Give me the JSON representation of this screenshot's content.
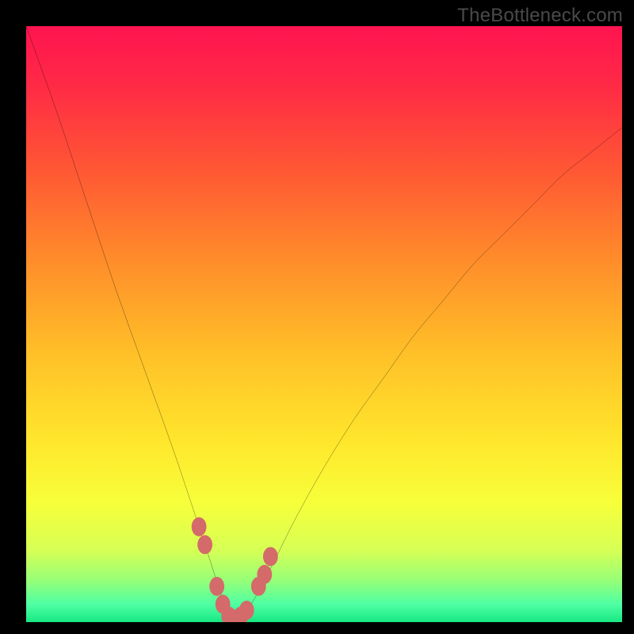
{
  "watermark": "TheBottleneck.com",
  "gradient_stops": [
    {
      "offset": 0.0,
      "color": "#ff1450"
    },
    {
      "offset": 0.1,
      "color": "#ff2a45"
    },
    {
      "offset": 0.25,
      "color": "#ff5a33"
    },
    {
      "offset": 0.4,
      "color": "#ff8f2a"
    },
    {
      "offset": 0.55,
      "color": "#ffc028"
    },
    {
      "offset": 0.7,
      "color": "#ffe72c"
    },
    {
      "offset": 0.8,
      "color": "#f7ff3a"
    },
    {
      "offset": 0.88,
      "color": "#d6ff55"
    },
    {
      "offset": 0.93,
      "color": "#96ff77"
    },
    {
      "offset": 0.97,
      "color": "#4fffa4"
    },
    {
      "offset": 1.0,
      "color": "#17e884"
    }
  ],
  "chart_data": {
    "type": "line",
    "title": "",
    "xlabel": "",
    "ylabel": "",
    "xlim": [
      0,
      100
    ],
    "ylim": [
      0,
      100
    ],
    "grid": false,
    "x": [
      0,
      5,
      10,
      15,
      20,
      25,
      30,
      33,
      35,
      37,
      40,
      45,
      50,
      55,
      60,
      65,
      70,
      75,
      80,
      85,
      90,
      95,
      100
    ],
    "series": [
      {
        "name": "bottleneck-curve",
        "values": [
          100,
          86,
          71,
          56,
          42,
          28,
          13,
          4,
          1,
          2,
          7,
          17,
          26,
          34,
          41,
          48,
          54,
          60,
          65,
          70,
          75,
          79,
          83
        ]
      }
    ],
    "markers": {
      "name": "highlight-zone",
      "color": "#d46a6a",
      "points": [
        {
          "x": 29,
          "y": 16
        },
        {
          "x": 30,
          "y": 13
        },
        {
          "x": 32,
          "y": 6
        },
        {
          "x": 33,
          "y": 3
        },
        {
          "x": 34,
          "y": 1
        },
        {
          "x": 35,
          "y": 0.5
        },
        {
          "x": 36,
          "y": 1
        },
        {
          "x": 37,
          "y": 2
        },
        {
          "x": 39,
          "y": 6
        },
        {
          "x": 40,
          "y": 8
        },
        {
          "x": 41,
          "y": 11
        }
      ]
    }
  }
}
